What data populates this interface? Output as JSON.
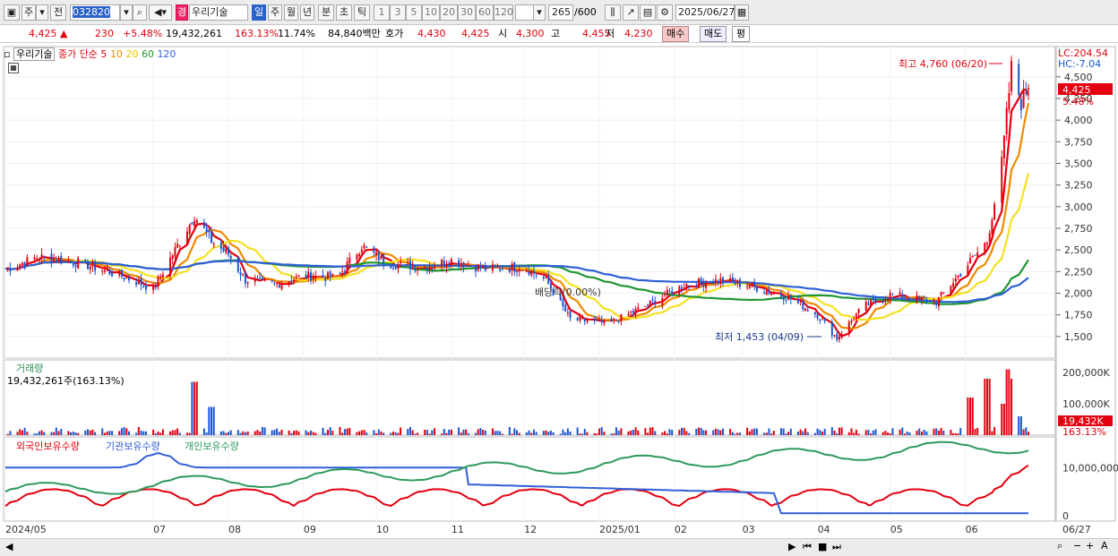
{
  "toolbar": {
    "market": "주",
    "prev_label": "전",
    "code": "032820",
    "stock_name": "우리기술",
    "name_badge": "경",
    "periods": [
      "일",
      "주",
      "월",
      "년",
      "분",
      "초",
      "틱"
    ],
    "selected_period": "일",
    "intervals": [
      "1",
      "3",
      "5",
      "10",
      "20",
      "30",
      "60",
      "120"
    ],
    "count": "265",
    "total": "/600",
    "date": "2025/06/27"
  },
  "quote": {
    "price": "4,425",
    "arrow": "▲",
    "change": "230",
    "change_pct": "+5.48%",
    "volume": "19,432,261",
    "volume_ratio": "163.13%",
    "turnover": "11.74%",
    "amount": "84,840백만",
    "hoga_label": "호가",
    "bid": "4,430",
    "ask": "4,425",
    "open_label": "시",
    "open": "4,300",
    "high_label": "고",
    "high": "4,455",
    "low_label": "저",
    "low": "4,230",
    "buy_label": "매수",
    "sell_label": "매도",
    "avg_label": "평"
  },
  "colors": {
    "up": "#e4000f",
    "down": "#1a55d0",
    "ma5": "#e4000f",
    "ma10": "#f08a00",
    "ma20": "#f5e11e",
    "ma60": "#1e9630",
    "ma120": "#2f5fd8",
    "foreign": "#e4000f",
    "institution": "#2f5fd8",
    "individual": "#2e9a5a"
  },
  "chart_data": [
    {
      "type": "candlestick",
      "title": "우리기술",
      "legend": [
        {
          "name": "종가 단순 5"
        },
        {
          "name": "10"
        },
        {
          "name": "20"
        },
        {
          "name": "60"
        },
        {
          "name": "120"
        }
      ],
      "x_ticks": [
        "2024/05",
        "07",
        "08",
        "09",
        "10",
        "11",
        "12",
        "2025/01",
        "02",
        "03",
        "04",
        "05",
        "06",
        "06/27"
      ],
      "y_ticks": [
        "4,500",
        "4,250",
        "4,000",
        "3,750",
        "3,500",
        "3,250",
        "3,000",
        "2,750",
        "2,500",
        "2,250",
        "2,000",
        "1,750",
        "1,500"
      ],
      "ylim": [
        1250,
        4850
      ],
      "lc": "LC:204.54",
      "hc": "HC:-7.04",
      "current_price": "4,425",
      "current_pct": "5.48%",
      "annotations": {
        "high": "최고 4,760 (06/20)",
        "low": "최저 1,453 (04/09)",
        "dividend": "배당락(0.00%)"
      },
      "price_path": [
        [
          "2024-05-01",
          2280
        ],
        [
          "2024-05-15",
          2420
        ],
        [
          "2024-06-01",
          2350
        ],
        [
          "2024-06-20",
          2180
        ],
        [
          "2024-07-01",
          2050
        ],
        [
          "2024-07-10",
          2500
        ],
        [
          "2024-07-18",
          2900
        ],
        [
          "2024-07-25",
          2600
        ],
        [
          "2024-08-01",
          2450
        ],
        [
          "2024-08-08",
          2150
        ],
        [
          "2024-08-20",
          2100
        ],
        [
          "2024-09-01",
          2200
        ],
        [
          "2024-09-15",
          2180
        ],
        [
          "2024-09-25",
          2550
        ],
        [
          "2024-10-05",
          2350
        ],
        [
          "2024-10-20",
          2300
        ],
        [
          "2024-11-01",
          2380
        ],
        [
          "2024-11-15",
          2280
        ],
        [
          "2024-12-01",
          2300
        ],
        [
          "2024-12-10",
          2150
        ],
        [
          "2024-12-20",
          1700
        ],
        [
          "2025-01-05",
          1650
        ],
        [
          "2025-01-20",
          1850
        ],
        [
          "2025-02-05",
          2100
        ],
        [
          "2025-02-20",
          2150
        ],
        [
          "2025-03-05",
          2080
        ],
        [
          "2025-03-20",
          1950
        ],
        [
          "2025-04-01",
          1750
        ],
        [
          "2025-04-09",
          1480
        ],
        [
          "2025-04-20",
          1850
        ],
        [
          "2025-05-01",
          1980
        ],
        [
          "2025-05-20",
          1900
        ],
        [
          "2025-06-01",
          2300
        ],
        [
          "2025-06-10",
          2600
        ],
        [
          "2025-06-16",
          3500
        ],
        [
          "2025-06-20",
          4600
        ],
        [
          "2025-06-24",
          4200
        ],
        [
          "2025-06-27",
          4425
        ]
      ]
    },
    {
      "type": "bar",
      "title": "거래량",
      "summary": "19,432,261주(163.13%)",
      "y_ticks": [
        "200,000K",
        "100,000K"
      ],
      "current": "19,432K",
      "current_pct": "163.13%",
      "ylim": [
        0,
        240000
      ],
      "spikes_k": [
        [
          "2024-07-18",
          170000
        ],
        [
          "2024-07-25",
          90000
        ],
        [
          "2025-06-03",
          120000
        ],
        [
          "2025-06-10",
          180000
        ],
        [
          "2025-06-16",
          100000
        ],
        [
          "2025-06-18",
          210000
        ],
        [
          "2025-06-19",
          180000
        ],
        [
          "2025-06-20",
          150000
        ],
        [
          "2025-06-23",
          60000
        ]
      ]
    },
    {
      "type": "line",
      "title": "보유수량",
      "series": [
        {
          "name": "외국인보유수량"
        },
        {
          "name": "기관보유수량"
        },
        {
          "name": "개인보유수량"
        }
      ],
      "y_ticks": [
        "10,000,000",
        "0"
      ]
    }
  ]
}
